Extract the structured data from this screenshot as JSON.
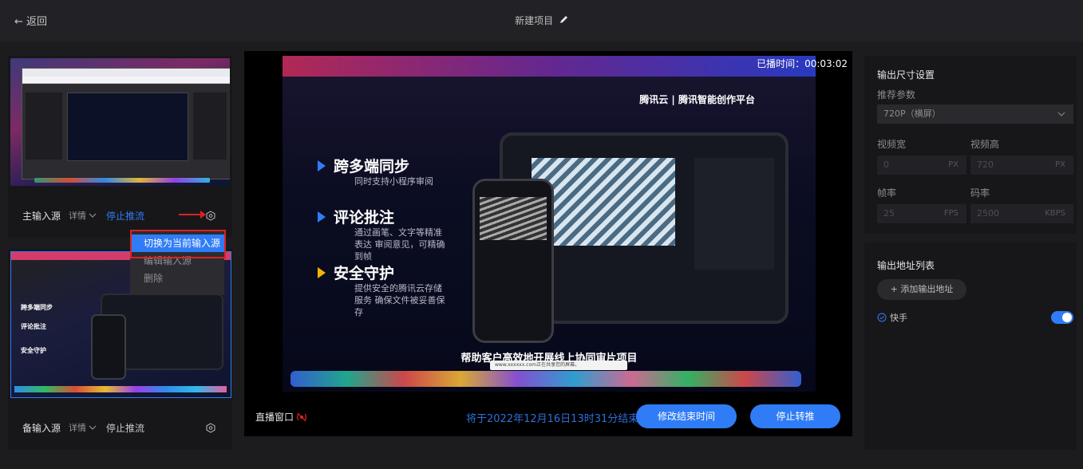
{
  "header": {
    "back_label": "← 返回",
    "title": "新建项目"
  },
  "left": {
    "primary": {
      "label": "主输入源",
      "detail": "详情",
      "stop": "停止推流"
    },
    "backup": {
      "label": "备输入源",
      "detail": "详情",
      "stop": "停止推流"
    },
    "menu": {
      "items": [
        "切换为当前输入源",
        "编辑输入源",
        "删除"
      ]
    },
    "thumb_slides": [
      "跨多端同步",
      "评论批注",
      "安全守护"
    ]
  },
  "preview": {
    "played_label": "已播时间：",
    "played_time": "00:03:02",
    "brand": "腾讯云 | 腾讯智能创作平台",
    "features": [
      {
        "title": "跨多端同步",
        "sub": "同时支持小程序审阅"
      },
      {
        "title": "评论批注",
        "sub": "通过画笔、文字等精准表达 审阅意见，可精确到帧"
      },
      {
        "title": "安全守护",
        "sub": "提供安全的腾讯云存储服务 确保文件被妥善保存"
      }
    ],
    "caption": "帮助客户高效地开展线上协同审片项目",
    "toast": "www.xxxxxx.com正在共享您的屏幕。"
  },
  "live": {
    "window_label": "直播窗口",
    "end_text": "将于2022年12月16日13时31分结束",
    "modify_button": "修改结束时间",
    "stop_button": "停止转推"
  },
  "output_size": {
    "heading": "输出尺寸设置",
    "recommend_label": "推荐参数",
    "recommend_value": "720P（横屏）",
    "width_label": "视频宽",
    "width_value": "0",
    "width_unit": "PX",
    "height_label": "视频高",
    "height_value": "720",
    "height_unit": "PX",
    "fps_label": "帧率",
    "fps_value": "25",
    "fps_unit": "FPS",
    "bitrate_label": "码率",
    "bitrate_value": "2500",
    "bitrate_unit": "KBPS"
  },
  "output_list": {
    "heading": "输出地址列表",
    "add_button": "+ 添加输出地址",
    "items": [
      {
        "name": "快手",
        "enabled": true
      }
    ]
  },
  "colors": {
    "accent": "#2f7cf6",
    "annotation": "#e02020",
    "bg": "#1c1c1f"
  }
}
